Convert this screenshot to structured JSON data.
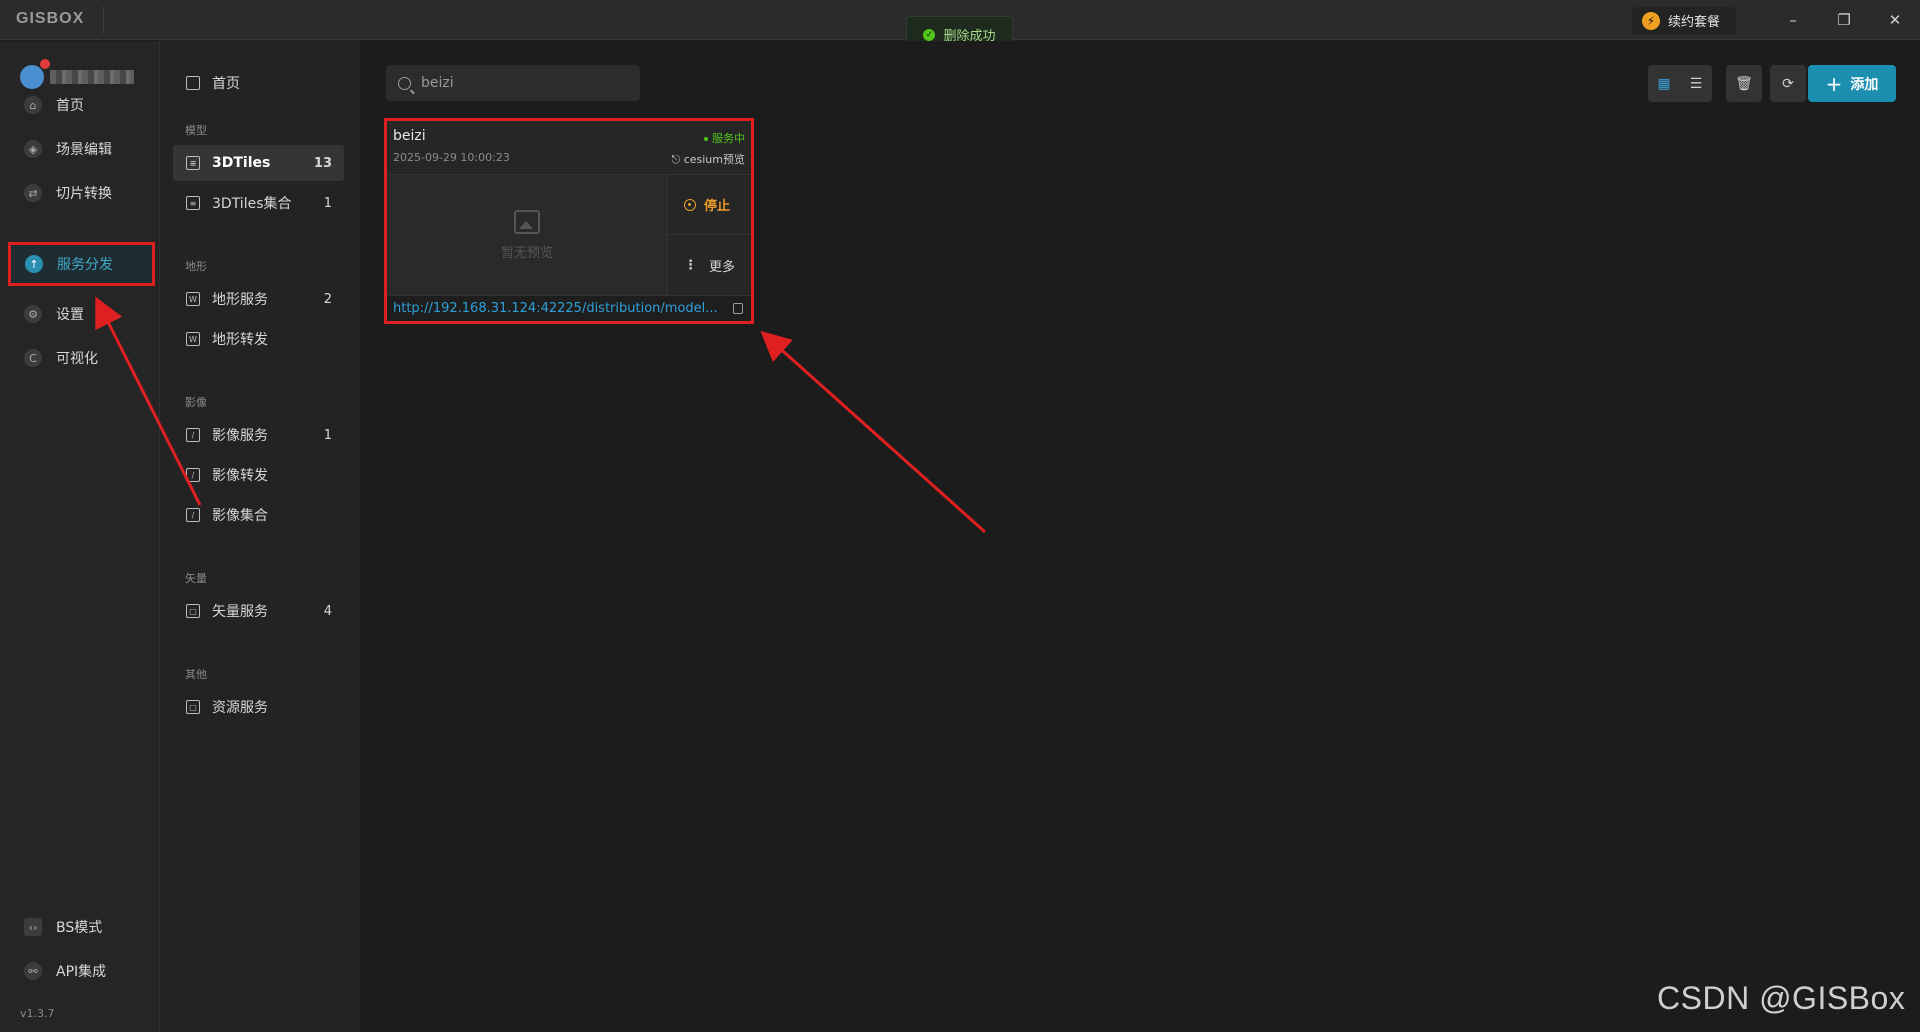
{
  "titlebar": {
    "logo": "GISBOX",
    "renew_label": "续约套餐",
    "minimize": "–",
    "restore": "❐",
    "close": "✕"
  },
  "toast": {
    "text": "删除成功",
    "color": "#52c41a"
  },
  "user": {
    "name_obscured": true
  },
  "sidebar": {
    "items": [
      {
        "label": "首页",
        "icon": "home-icon"
      },
      {
        "label": "场景编辑",
        "icon": "cube-icon"
      },
      {
        "label": "切片转换",
        "icon": "convert-icon"
      },
      {
        "label": "服务分发",
        "icon": "upload-cloud-icon",
        "active": true
      },
      {
        "label": "设置",
        "icon": "gear-icon"
      },
      {
        "label": "可视化",
        "icon": "chart-icon"
      }
    ],
    "bottom": [
      {
        "label": "BS模式",
        "icon": "code-icon"
      },
      {
        "label": "API集成",
        "icon": "link-icon"
      }
    ],
    "version": "v1.3.7"
  },
  "subnav": {
    "home": "首页",
    "groups": [
      {
        "title": "模型",
        "items": [
          {
            "label": "3DTiles",
            "count": "13",
            "active": true
          },
          {
            "label": "3DTiles集合",
            "count": "1"
          }
        ]
      },
      {
        "title": "地形",
        "items": [
          {
            "label": "地形服务",
            "count": "2"
          },
          {
            "label": "地形转发",
            "count": ""
          }
        ]
      },
      {
        "title": "影像",
        "items": [
          {
            "label": "影像服务",
            "count": "1"
          },
          {
            "label": "影像转发",
            "count": ""
          },
          {
            "label": "影像集合",
            "count": ""
          }
        ]
      },
      {
        "title": "矢量",
        "items": [
          {
            "label": "矢量服务",
            "count": "4"
          }
        ]
      },
      {
        "title": "其他",
        "items": [
          {
            "label": "资源服务",
            "count": ""
          }
        ]
      }
    ]
  },
  "main": {
    "search_value": "beizi",
    "add_label": "添加",
    "card": {
      "title": "beizi",
      "status": "服务中",
      "date": "2025-09-29 10:00:23",
      "preview_tag": "cesium预览",
      "no_preview": "暂无预览",
      "stop_label": "停止",
      "more_label": "更多",
      "url": "http://192.168.31.124:42225/distribution/model..."
    }
  },
  "watermark": "CSDN @GISBox",
  "colors": {
    "accent": "#1c8fb0",
    "highlight": "#e02020",
    "stop": "#e89a2a",
    "link": "#2f9fd8"
  }
}
